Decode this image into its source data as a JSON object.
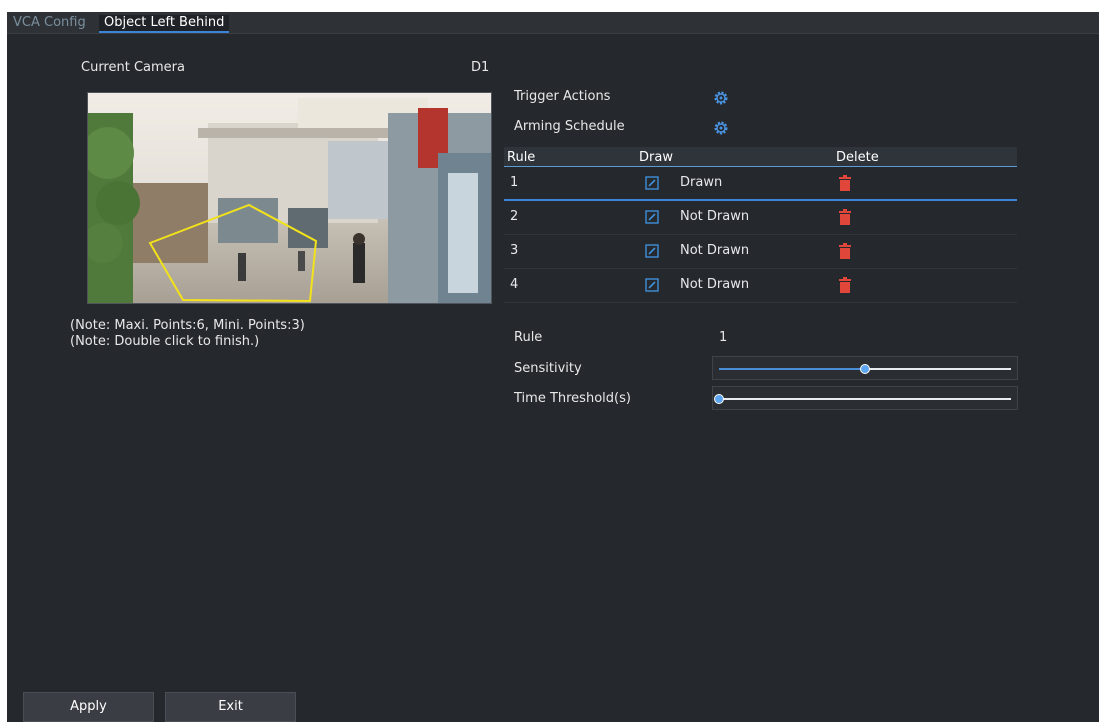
{
  "tabs": {
    "parent": "VCA Config",
    "current": "Object Left Behind"
  },
  "camera": {
    "label": "Current Camera",
    "value": "D1"
  },
  "notes": {
    "points": "(Note: Maxi. Points:6, Mini. Points:3)",
    "finish": "(Note: Double click to finish.)"
  },
  "actions": {
    "trigger_label": "Trigger Actions",
    "arming_label": "Arming Schedule",
    "icon": "gear-icon"
  },
  "rules_table": {
    "headers": {
      "rule": "Rule",
      "draw": "Draw",
      "delete": "Delete"
    },
    "rows": [
      {
        "rule": "1",
        "status": "Drawn"
      },
      {
        "rule": "2",
        "status": "Not Drawn"
      },
      {
        "rule": "3",
        "status": "Not Drawn"
      },
      {
        "rule": "4",
        "status": "Not Drawn"
      }
    ],
    "selected_row": "1"
  },
  "settings": {
    "rule_label": "Rule",
    "rule_value": "1",
    "sensitivity_label": "Sensitivity",
    "sensitivity_level": 0.5,
    "time_threshold_label": "Time Threshold(s)",
    "time_threshold_level": 0.0
  },
  "buttons": {
    "apply": "Apply",
    "exit": "Exit"
  },
  "colors": {
    "accent": "#3b84d8",
    "delete": "#e0463a",
    "region": "#f2e21b",
    "edit": "#3f8fd8"
  }
}
